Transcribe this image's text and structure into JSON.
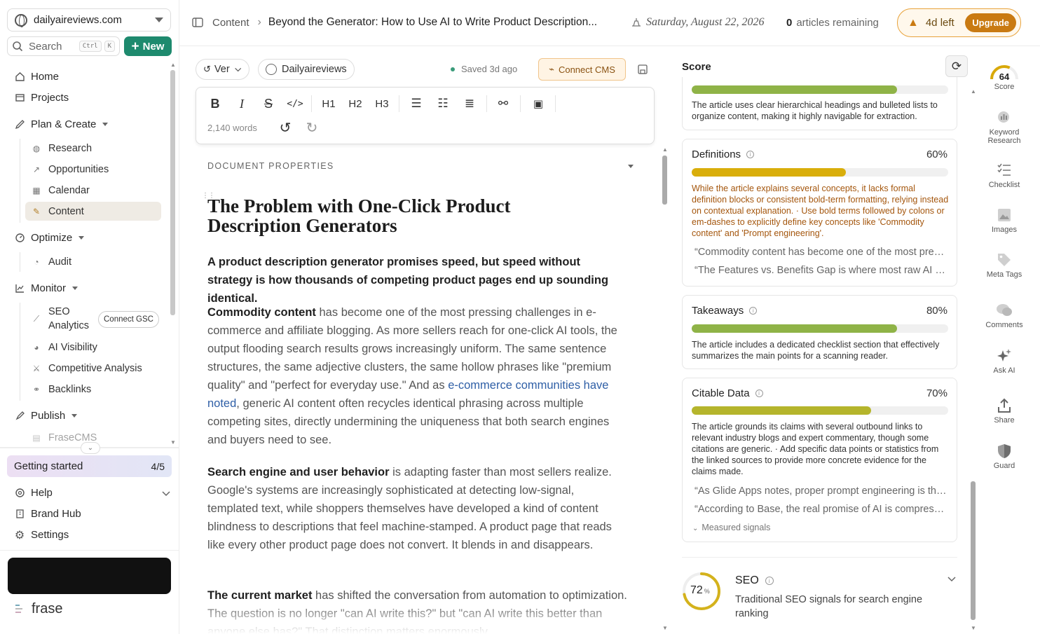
{
  "sidebar": {
    "site": "dailyaireviews.com",
    "search_label": "Search",
    "kbd_ctrl": "Ctrl",
    "kbd_k": "K",
    "new_label": "New",
    "home": "Home",
    "projects": "Projects",
    "plan_create": "Plan & Create",
    "plan_items": [
      "Research",
      "Opportunities",
      "Calendar",
      "Content"
    ],
    "optimize": "Optimize",
    "optimize_items": [
      "Audit"
    ],
    "monitor": "Monitor",
    "monitor_items": [
      "SEO Analytics",
      "AI Visibility",
      "Competitive Analysis",
      "Backlinks"
    ],
    "connect_gsc": "Connect GSC",
    "publish": "Publish",
    "publish_items": [
      "FraseCMS"
    ],
    "getting_started": "Getting started",
    "getting_started_count": "4/5",
    "help": "Help",
    "brand_hub": "Brand Hub",
    "settings": "Settings",
    "logo": "frase"
  },
  "header": {
    "breadcrumb_root": "Content",
    "breadcrumb_title": "Beyond the Generator: How to Use AI to Write Product Description...",
    "date": "Saturday, August 22, 2026",
    "articles_count": "0",
    "articles_label": "articles remaining",
    "trial_label": "4d left",
    "upgrade_label": "Upgrade"
  },
  "editor": {
    "version_label": "Ver",
    "brand_label": "Dailyaireviews",
    "saved_label": "Saved 3d ago",
    "connect_cms_label": "Connect CMS",
    "toolbar": {
      "h1": "H1",
      "h2": "H2",
      "h3": "H3"
    },
    "word_count": "2,140 words",
    "doc_props_label": "DOCUMENT PROPERTIES",
    "heading": "The Problem with One-Click Product Description Generators",
    "lead": "A product description generator promises speed, but speed without strategy is how thousands of competing product pages end up sounding identical.",
    "p1_bold": "Commodity content",
    "p1_a": " has become one of the most pressing challenges in e-commerce and affiliate blogging. As more sellers reach for one-click AI tools, the output flooding search results grows increasingly uniform. The same sentence structures, the same adjective clusters, the same hollow phrases like \"premium quality\" and \"perfect for everyday use.\" And as ",
    "p1_link": "e-commerce communities have noted",
    "p1_b": ", generic AI content often recycles identical phrasing across multiple competing sites, directly undermining the uniqueness that both search engines and buyers need to see.",
    "p2_bold": "Search engine and user behavior",
    "p2_text": " is adapting faster than most sellers realize. Google's systems are increasingly sophisticated at detecting low-signal, templated text, while shoppers themselves have developed a kind of content blindness to descriptions that feel machine-stamped. A product page that reads like every other product page does not convert. It blends in and disappears.",
    "p3_bold": "The current market",
    "p3_text": " has shifted the conversation from automation to optimization. The question is no longer \"can AI write this?\" but \"can AI write this better than anyone else has?\" That distinction matters enormously."
  },
  "score_panel": {
    "title": "Score",
    "structure_desc": "The article uses clear hierarchical headings and bulleted lists to organize content, making it highly navigable for extraction.",
    "structure_value": 0.8,
    "cards": [
      {
        "name": "Definitions",
        "pct": "60%",
        "value": 0.6,
        "color": "#d9ae0b",
        "desc": "While the article explains several concepts, it lacks formal definition blocks or consistent bold-term formatting, relying instead on contextual explanation. · Use bold terms followed by colons or em-dashes to explicitly define key concepts like 'Commodity content' and 'Prompt engineering'.",
        "quotes": [
          "“Commodity content has become one of the most pressing challenges in e-commerce",
          "“The Features vs. Benefits Gap is where most raw AI output fails"
        ]
      },
      {
        "name": "Takeaways",
        "pct": "80%",
        "value": 0.8,
        "color": "#8fb347",
        "desc": "The article includes a dedicated checklist section that effectively summarizes the main points for a scanning reader.",
        "quotes": []
      },
      {
        "name": "Citable Data",
        "pct": "70%",
        "value": 0.7,
        "color": "#b5b52c",
        "desc": "The article grounds its claims with several outbound links to relevant industry blogs and expert commentary, though some citations are generic. · Add specific data points or statistics from the linked sources to provide more concrete evidence for the claims made.",
        "quotes": [
          "“As Glide Apps notes, proper prompt engineering is the difference",
          "“According to Base, the real promise of AI is compressing the timeline"
        ],
        "measured": "Measured signals"
      }
    ],
    "seo": {
      "value": "72",
      "unit": "%",
      "fraction": 0.72,
      "title": "SEO",
      "desc": "Traditional SEO signals for search engine ranking"
    }
  },
  "rail": {
    "score_value": "64",
    "score_fraction": 0.64,
    "score_label": "Score",
    "items": [
      "Keyword Research",
      "Checklist",
      "Images",
      "Meta Tags",
      "Comments",
      "Ask AI",
      "Share",
      "Guard"
    ]
  },
  "colors": {
    "brand_green": "#1e8a6e",
    "upgrade": "#c97a12",
    "score_green": "#8fb347",
    "link": "#2f5fa6"
  }
}
